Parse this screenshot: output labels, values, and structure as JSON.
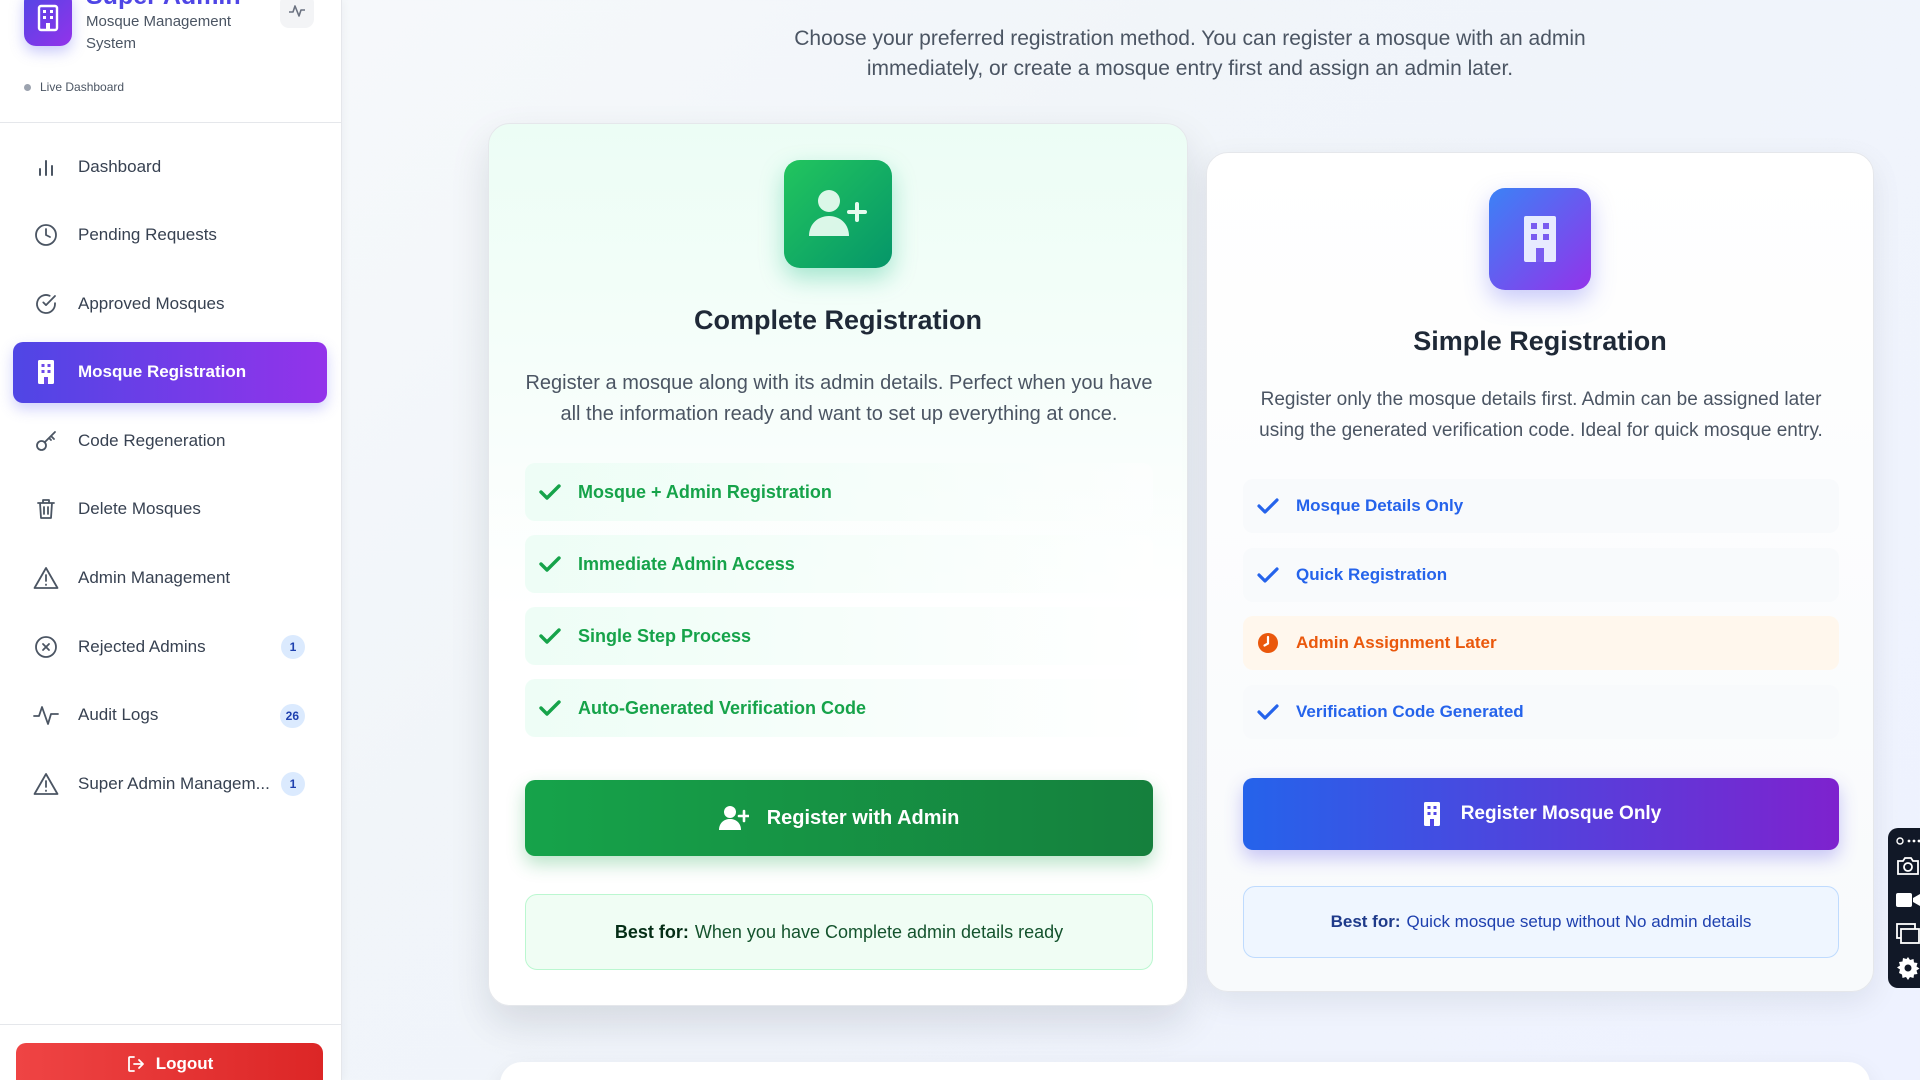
{
  "brand": {
    "title": "Super Admin",
    "subtitle": "Mosque Management System",
    "live_label": "Live Dashboard"
  },
  "nav": {
    "items": [
      {
        "label": "Dashboard",
        "icon": "bar-chart-icon"
      },
      {
        "label": "Pending Requests",
        "icon": "clock-icon"
      },
      {
        "label": "Approved Mosques",
        "icon": "check-circle-icon"
      },
      {
        "label": "Mosque Registration",
        "icon": "building-icon",
        "active": true
      },
      {
        "label": "Code Regeneration",
        "icon": "key-icon"
      },
      {
        "label": "Delete Mosques",
        "icon": "trash-icon"
      },
      {
        "label": "Admin Management",
        "icon": "warning-icon"
      },
      {
        "label": "Rejected Admins",
        "icon": "x-circle-icon",
        "badge": "1"
      },
      {
        "label": "Audit Logs",
        "icon": "activity-icon",
        "badge": "26"
      },
      {
        "label": "Super Admin Managem...",
        "icon": "warning-icon",
        "badge": "1"
      }
    ],
    "logout_label": "Logout"
  },
  "main": {
    "intro": "Choose your preferred registration method. You can register a mosque with an admin immediately, or create a mosque entry first and assign an admin later.",
    "complete": {
      "title": "Complete Registration",
      "description": "Register a mosque along with its admin details. Perfect when you have all the information ready and want to set up everything at once.",
      "features": [
        "Mosque + Admin Registration",
        "Immediate Admin Access",
        "Single Step Process",
        "Auto-Generated Verification Code"
      ],
      "button": "Register with Admin",
      "best_for_label": "Best for:",
      "best_for_text": "When you have Complete admin details ready"
    },
    "simple": {
      "title": "Simple Registration",
      "description": "Register only the mosque details first. Admin can be assigned later using the generated verification code. Ideal for quick mosque entry.",
      "features": [
        {
          "label": "Mosque Details Only",
          "icon": "check-icon"
        },
        {
          "label": "Quick Registration",
          "icon": "check-icon"
        },
        {
          "label": "Admin Assignment Later",
          "icon": "clock-icon"
        },
        {
          "label": "Verification Code Generated",
          "icon": "check-icon"
        }
      ],
      "button": "Register Mosque Only",
      "best_for_label": "Best for:",
      "best_for_text": "Quick mosque setup without No admin details"
    }
  },
  "colors": {
    "accent_indigo": "#4f46e5",
    "accent_purple": "#9333ea",
    "green": "#16a34a",
    "blue": "#2563eb",
    "orange": "#ea580c",
    "logout_red": "#dc2626"
  }
}
